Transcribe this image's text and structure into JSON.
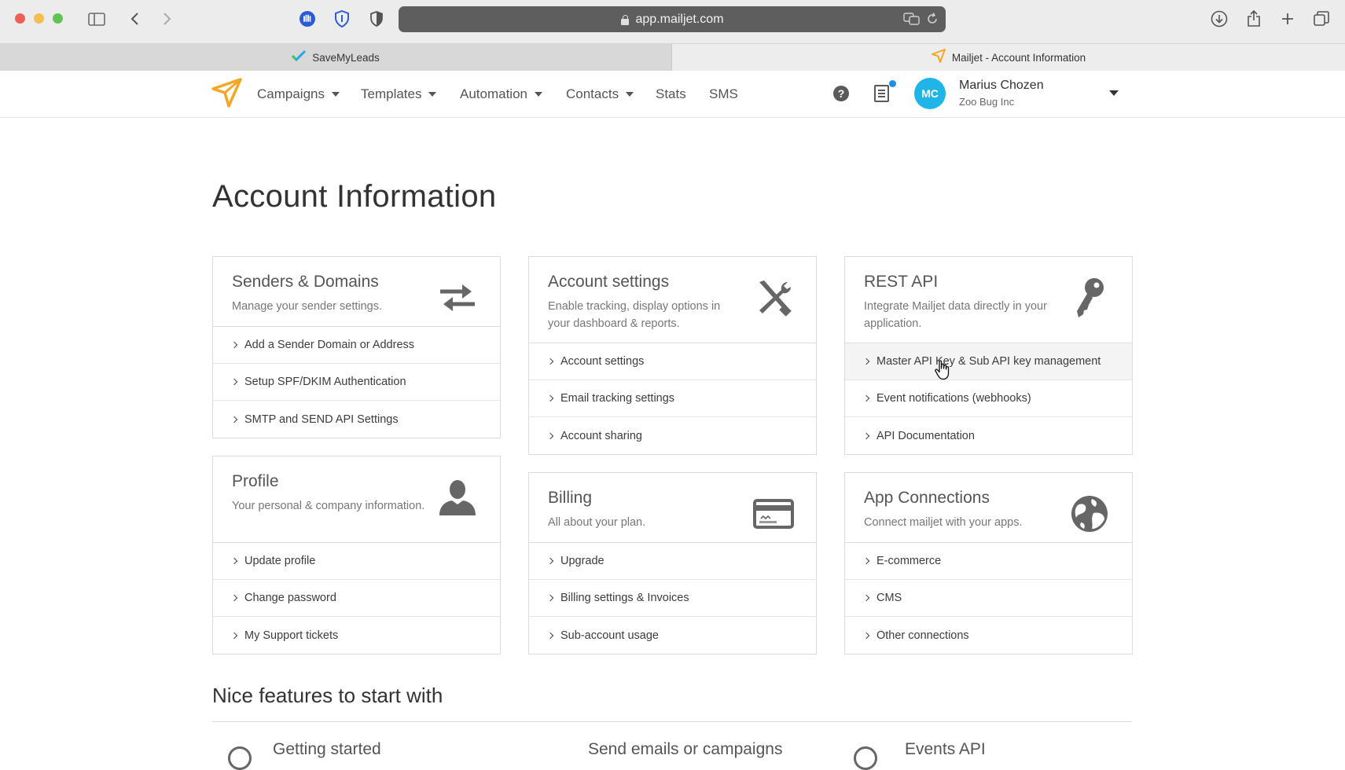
{
  "browser": {
    "url": "app.mailjet.com",
    "tabs": [
      {
        "label": "SaveMyLeads",
        "favicon": "check-favicon",
        "active": false
      },
      {
        "label": "Mailjet - Account Information",
        "favicon": "paper-plane-favicon",
        "active": true
      }
    ]
  },
  "nav": {
    "items": [
      {
        "label": "Campaigns",
        "dropdown": true
      },
      {
        "label": "Templates",
        "dropdown": true
      },
      {
        "label": "Automation",
        "dropdown": true
      },
      {
        "label": "Contacts",
        "dropdown": true
      },
      {
        "label": "Stats",
        "dropdown": false
      },
      {
        "label": "SMS",
        "dropdown": false
      }
    ],
    "help_glyph": "?",
    "user": {
      "initials": "MC",
      "name": "Marius Chozen",
      "company": "Zoo Bug Inc"
    },
    "colors": {
      "accent": "#f5a623",
      "avatar": "#1fb5e8",
      "notification_dot": "#1e90e8"
    }
  },
  "page": {
    "title": "Account Information"
  },
  "cards": [
    {
      "title": "Senders & Domains",
      "description": "Manage your sender settings.",
      "icon": "swap-arrows-icon",
      "links": [
        "Add a Sender Domain or Address",
        "Setup SPF/DKIM Authentication",
        "SMTP and SEND API Settings"
      ]
    },
    {
      "title": "Account settings",
      "description": "Enable tracking, display options in your dashboard & reports.",
      "icon": "tools-icon",
      "links": [
        "Account settings",
        "Email tracking settings",
        "Account sharing"
      ]
    },
    {
      "title": "REST API",
      "description": "Integrate Mailjet data directly in your application.",
      "icon": "key-icon",
      "links": [
        "Master API Key & Sub API key management",
        "Event notifications (webhooks)",
        "API Documentation"
      ]
    },
    {
      "title": "Profile",
      "description": "Your personal & company information.",
      "icon": "user-icon",
      "links": [
        "Update profile",
        "Change password",
        "My Support tickets"
      ]
    },
    {
      "title": "Billing",
      "description": "All about your plan.",
      "icon": "credit-card-icon",
      "links": [
        "Upgrade",
        "Billing settings & Invoices",
        "Sub-account usage"
      ]
    },
    {
      "title": "App Connections",
      "description": "Connect mailjet with your apps.",
      "icon": "globe-icon",
      "links": [
        "E-commerce",
        "CMS",
        "Other connections"
      ]
    }
  ],
  "features": {
    "title": "Nice features to start with",
    "items": [
      "Getting started",
      "Send emails or campaigns",
      "Events API"
    ]
  }
}
